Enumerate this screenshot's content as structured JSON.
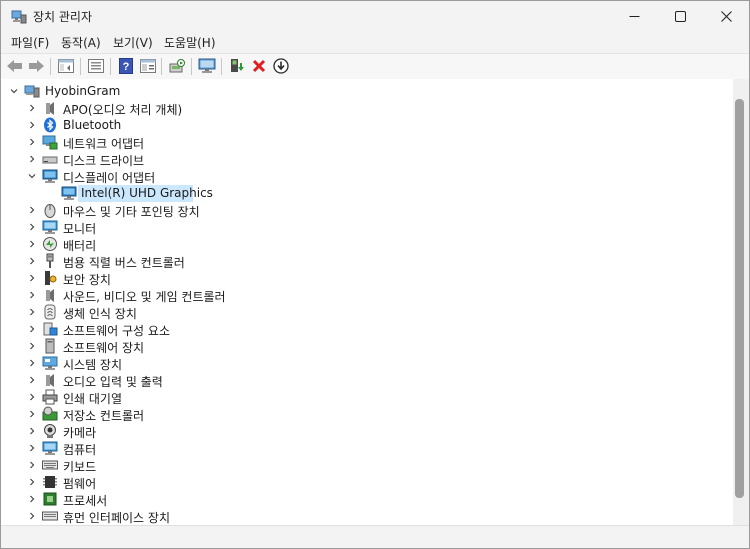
{
  "window": {
    "title": "장치 관리자",
    "controls": {
      "minimize": "—",
      "maximize": "☐",
      "close": "✕"
    }
  },
  "menu": [
    "파일(F)",
    "동작(A)",
    "보기(V)",
    "도움말(H)"
  ],
  "toolbar": {
    "buttons": [
      "back-arrow-icon",
      "forward-arrow-icon",
      "show-hide-console-tree-icon",
      "properties-icon",
      "help-icon",
      "view-icon",
      "scan-hardware-icon",
      "monitor-icon",
      "update-driver-icon",
      "uninstall-icon",
      "download-icon"
    ]
  },
  "tree": {
    "root": "HyobinGram",
    "categories": [
      "APO(오디오 처리 개체)",
      "Bluetooth",
      "네트워크 어댑터",
      "디스크 드라이브",
      "디스플레이 어댑터",
      "마우스 및 기타 포인팅 장치",
      "모니터",
      "배터리",
      "범용 직렬 버스 컨트롤러",
      "보안 장치",
      "사운드, 비디오 및 게임 컨트롤러",
      "생체 인식 장치",
      "소프트웨어 구성 요소",
      "소프트웨어 장치",
      "시스템 장치",
      "오디오 입력 및 출력",
      "인쇄 대기열",
      "저장소 컨트롤러",
      "카메라",
      "컴퓨터",
      "키보드",
      "펌웨어",
      "프로세서",
      "휴먼 인터페이스 장치"
    ],
    "expanded_child": "Intel(R) UHD Graphics"
  },
  "colors": {
    "selection": "#cce8ff",
    "chrome": "#f3f3f3",
    "bluetooth": "#1e6fd9"
  }
}
